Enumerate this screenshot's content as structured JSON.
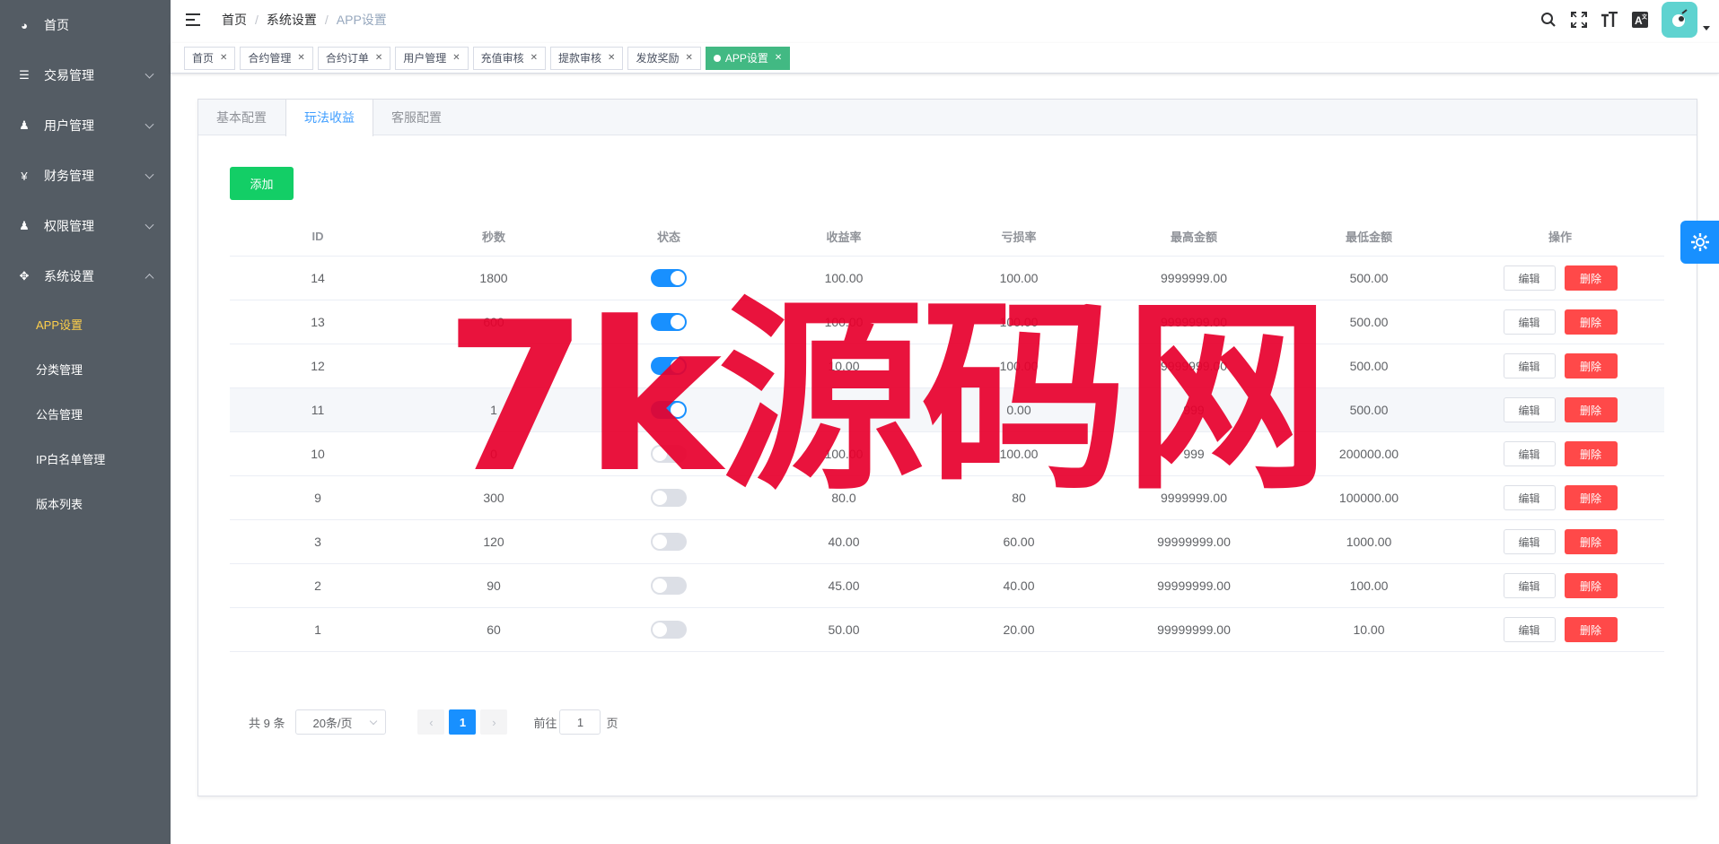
{
  "sidebar": {
    "items": [
      {
        "label": "首页",
        "icon": "dashboard-icon",
        "glyph": "◕"
      },
      {
        "label": "交易管理",
        "icon": "list-icon",
        "glyph": "☰"
      },
      {
        "label": "用户管理",
        "icon": "users-icon",
        "glyph": "♟"
      },
      {
        "label": "财务管理",
        "icon": "yen-icon",
        "glyph": "¥"
      },
      {
        "label": "权限管理",
        "icon": "user-icon",
        "glyph": "♟"
      },
      {
        "label": "系统设置",
        "icon": "move-icon",
        "glyph": "✥"
      }
    ],
    "submenu": [
      {
        "label": "APP设置",
        "active": true
      },
      {
        "label": "分类管理"
      },
      {
        "label": "公告管理"
      },
      {
        "label": "IP白名单管理"
      },
      {
        "label": "版本列表"
      }
    ]
  },
  "header": {
    "breadcrumb": [
      "首页",
      "系统设置",
      "APP设置"
    ],
    "icons": {
      "search": "⚲",
      "fullscreen": "⛶",
      "fontsize": "Tт",
      "lang": "A"
    },
    "avatar_glyph": "🐘"
  },
  "tags": [
    {
      "label": "首页"
    },
    {
      "label": "合约管理"
    },
    {
      "label": "合约订单"
    },
    {
      "label": "用户管理"
    },
    {
      "label": "充值审核"
    },
    {
      "label": "提款审核"
    },
    {
      "label": "发放奖励"
    },
    {
      "label": "APP设置",
      "active": true
    }
  ],
  "tabs": [
    "基本配置",
    "玩法收益",
    "客服配置"
  ],
  "active_tab": "玩法收益",
  "add_label": "添加",
  "table": {
    "columns": [
      "ID",
      "秒数",
      "状态",
      "收益率",
      "亏损率",
      "最高金额",
      "最低金额",
      "操作"
    ],
    "rows": [
      {
        "id": "14",
        "seconds": "1800",
        "on": true,
        "ret": "100.00",
        "loss": "100.00",
        "max": "9999999.00",
        "min": "500.00"
      },
      {
        "id": "13",
        "seconds": "600",
        "on": true,
        "ret": "100.00",
        "loss": "100.00",
        "max": "9999999.00",
        "min": "500.00"
      },
      {
        "id": "12",
        "seconds": "",
        "on": true,
        "ret": "10.00",
        "loss": "100.00",
        "max": "9999999.00",
        "min": "500.00"
      },
      {
        "id": "11",
        "seconds": "1",
        "on": true,
        "ret": "",
        "loss": "0.00",
        "max": "999",
        "min": "500.00"
      },
      {
        "id": "10",
        "seconds": "0",
        "on": false,
        "ret": "100.00",
        "loss": "100.00",
        "max": "999",
        "min": "200000.00"
      },
      {
        "id": "9",
        "seconds": "300",
        "on": false,
        "ret": "80.0",
        "loss": "80",
        "max": "9999999.00",
        "min": "100000.00"
      },
      {
        "id": "3",
        "seconds": "120",
        "on": false,
        "ret": "40.00",
        "loss": "60.00",
        "max": "99999999.00",
        "min": "1000.00"
      },
      {
        "id": "2",
        "seconds": "90",
        "on": false,
        "ret": "45.00",
        "loss": "40.00",
        "max": "99999999.00",
        "min": "100.00"
      },
      {
        "id": "1",
        "seconds": "60",
        "on": false,
        "ret": "50.00",
        "loss": "20.00",
        "max": "99999999.00",
        "min": "10.00"
      }
    ],
    "edit_label": "编辑",
    "delete_label": "删除"
  },
  "pagination": {
    "total": "共 9 条",
    "page_size": "20条/页",
    "current_page": "1",
    "goto_prefix": "前往",
    "goto_value": "1",
    "goto_suffix": "页",
    "prev": "‹",
    "next": "›"
  },
  "watermark": "7k源码网",
  "colors": {
    "accent": "#1890ff",
    "success": "#13ce66",
    "danger": "#ff4949",
    "sidebar": "#545c64",
    "active_menu": "#ffd04b",
    "tag_active": "#42b983"
  }
}
